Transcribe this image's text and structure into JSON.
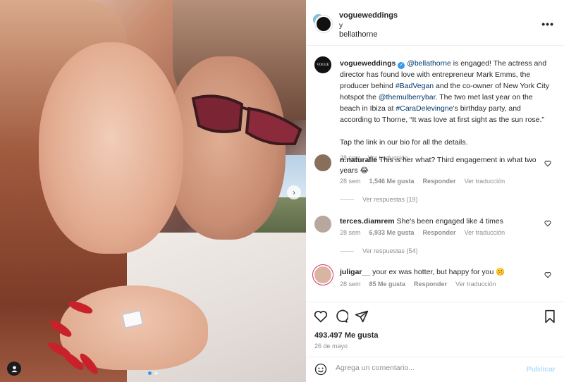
{
  "header": {
    "account_primary": "vogueweddings",
    "joiner": "y",
    "account_secondary": "bellathorne",
    "more_icon": "more-horizontal-icon"
  },
  "caption": {
    "avatar_text": "VOGUE",
    "username": "vogueweddings",
    "text_parts": [
      {
        "t": "@bellathorne",
        "link": true
      },
      {
        "t": " is engaged! The actress and director has found love with entrepreneur Mark Emms, the producer behind ",
        "link": false
      },
      {
        "t": "#BadVegan",
        "link": true
      },
      {
        "t": " and the co-owner of New York City hotspot the ",
        "link": false
      },
      {
        "t": "@themulberrybar",
        "link": true
      },
      {
        "t": ". The two met last year on the beach in Ibiza at ",
        "link": false
      },
      {
        "t": "#CaraDelevingne",
        "link": true
      },
      {
        "t": "'s birthday party, and according to Thorne, “It was love at first sight as the sun rose.”",
        "link": false
      }
    ],
    "line2": "Tap the link in our bio for all the details.",
    "time": "28 sem",
    "translate": "Ver traducción"
  },
  "comments": [
    {
      "username": "n.naturalle",
      "text": "This is her what? Third engagement in what two years 😂",
      "time": "28 sem",
      "likes": "1,546 Me gusta",
      "reply": "Responder",
      "translate": "Ver traducción",
      "replies": "Ver respuestas (19)",
      "avatar_color": "#8a6e5c"
    },
    {
      "username": "terces.diamrem",
      "text": "She's been engaged like 4 times",
      "time": "28 sem",
      "likes": "6,933 Me gusta",
      "reply": "Responder",
      "translate": "Ver traducción",
      "replies": "Ver respuestas (54)",
      "avatar_color": "#b7a79c"
    },
    {
      "username": "juligar__",
      "text": "your ex was hotter, but happy for you 🤫",
      "time": "28 sem",
      "likes": "85 Me gusta",
      "reply": "Responder",
      "translate": "Ver traducción",
      "replies": "",
      "avatar_color": "#d7b5a0"
    }
  ],
  "actions": {
    "likes": "493.497 Me gusta",
    "date": "26 de mayo"
  },
  "add_comment": {
    "placeholder": "Agrega un comentario...",
    "post_label": "Publicar"
  },
  "colors": {
    "link": "#00376b",
    "verified": "#3897f0",
    "muted": "#8e8e8e",
    "post_disabled": "#b2dffc"
  }
}
